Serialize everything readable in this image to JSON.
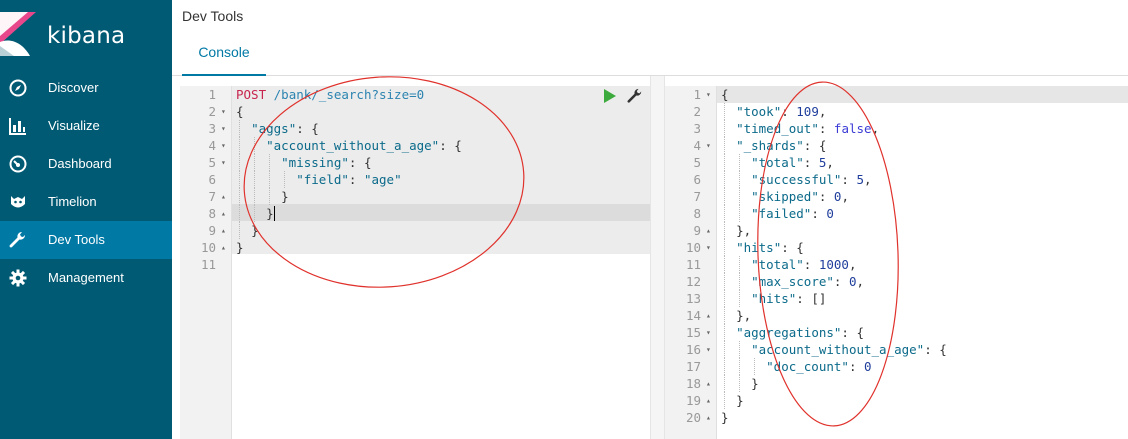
{
  "brand": {
    "name": "kibana"
  },
  "sidebar": {
    "items": [
      {
        "label": "Discover",
        "icon": "compass-icon",
        "active": false
      },
      {
        "label": "Visualize",
        "icon": "bar-chart-icon",
        "active": false
      },
      {
        "label": "Dashboard",
        "icon": "gauge-icon",
        "active": false
      },
      {
        "label": "Timelion",
        "icon": "timelion-icon",
        "active": false
      },
      {
        "label": "Dev Tools",
        "icon": "wrench-icon",
        "active": true
      },
      {
        "label": "Management",
        "icon": "gear-icon",
        "active": false
      }
    ]
  },
  "header": {
    "title": "Dev Tools",
    "tabs": [
      {
        "label": "Console",
        "active": true
      }
    ]
  },
  "request": {
    "method": "POST",
    "url": "/bank/_search?size=0",
    "line_numbers": [
      "1",
      "2",
      "3",
      "4",
      "5",
      "6",
      "7",
      "8",
      "9",
      "10",
      "11"
    ],
    "lines": [
      "{",
      "  \"aggs\": {",
      "    \"account_without_a_age\": {",
      "      \"missing\": {",
      "        \"field\": \"age\"",
      "      }",
      "    }",
      "  }",
      "}",
      ""
    ]
  },
  "response": {
    "line_numbers": [
      "1",
      "2",
      "3",
      "4",
      "5",
      "6",
      "7",
      "8",
      "9",
      "10",
      "11",
      "12",
      "13",
      "14",
      "15",
      "16",
      "17",
      "18",
      "19",
      "20"
    ],
    "lines": [
      "{",
      "  \"took\": 109,",
      "  \"timed_out\": false,",
      "  \"_shards\": {",
      "    \"total\": 5,",
      "    \"successful\": 5,",
      "    \"skipped\": 0,",
      "    \"failed\": 0",
      "  },",
      "  \"hits\": {",
      "    \"total\": 1000,",
      "    \"max_score\": 0,",
      "    \"hits\": []",
      "  },",
      "  \"aggregations\": {",
      "    \"account_without_a_age\": {",
      "      \"doc_count\": 0",
      "    }",
      "  }",
      "}"
    ]
  },
  "colors": {
    "sidebar": "#015a73",
    "active": "#0079a5",
    "annotation": "#e0322c"
  }
}
